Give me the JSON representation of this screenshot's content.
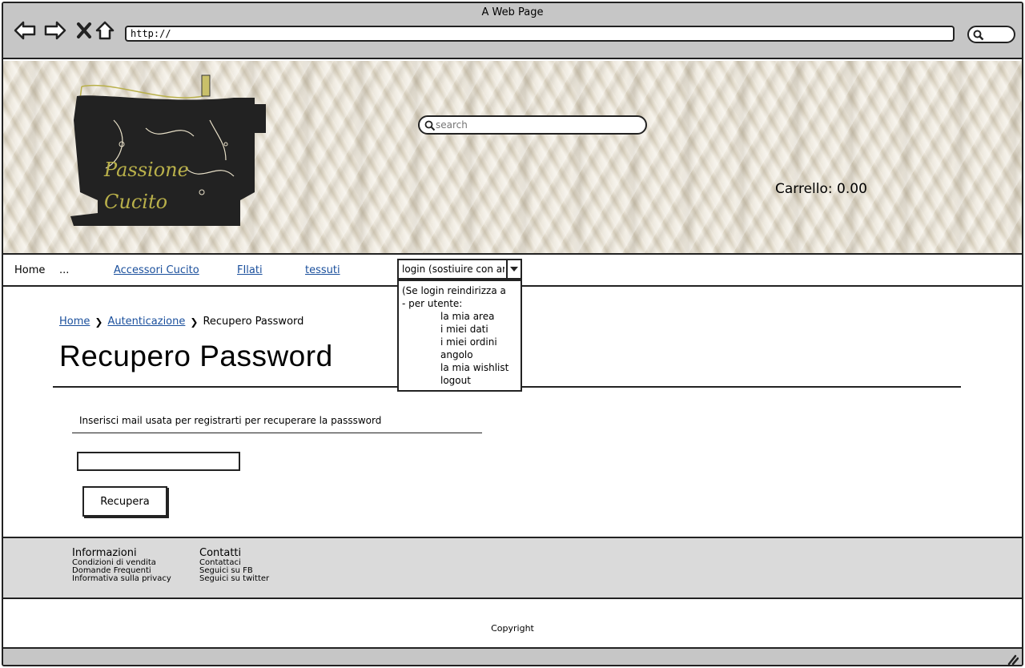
{
  "browser": {
    "title": "A Web Page",
    "url": "http://"
  },
  "header": {
    "logo_line1": "Passione",
    "logo_line2": "Cucito",
    "search_placeholder": "search",
    "cart": "Carrello: 0.00"
  },
  "nav": {
    "home": "Home",
    "ellipsis": "...",
    "accessori": "Accessori Cucito",
    "filati": "FIlati",
    "tessuti": "tessuti",
    "login_select": "login (sostiuire con area)"
  },
  "dropdown": {
    "line1": "(Se login reindirizza a",
    "line2": "- per utente:",
    "items": [
      "la mia area",
      "i miei dati",
      "i miei ordini",
      "angolo",
      "la mia wishlist",
      "logout"
    ]
  },
  "breadcrumb": {
    "home": "Home",
    "auth": "Autenticazione",
    "current": "Recupero Password"
  },
  "main": {
    "title": "Recupero Password",
    "instruction": "Inserisci mail usata per registrarti per recuperare la passsword",
    "email_value": "",
    "button": "Recupera"
  },
  "footer": {
    "info_title": "Informazioni",
    "info_links": [
      "Condizioni di vendita",
      "Domande Frequenti",
      "Informativa sulla privacy"
    ],
    "contact_title": "Contatti",
    "contact_links": [
      "Contattaci",
      "Seguici su FB",
      "Seguici su twitter"
    ],
    "copyright": "Copyright"
  }
}
